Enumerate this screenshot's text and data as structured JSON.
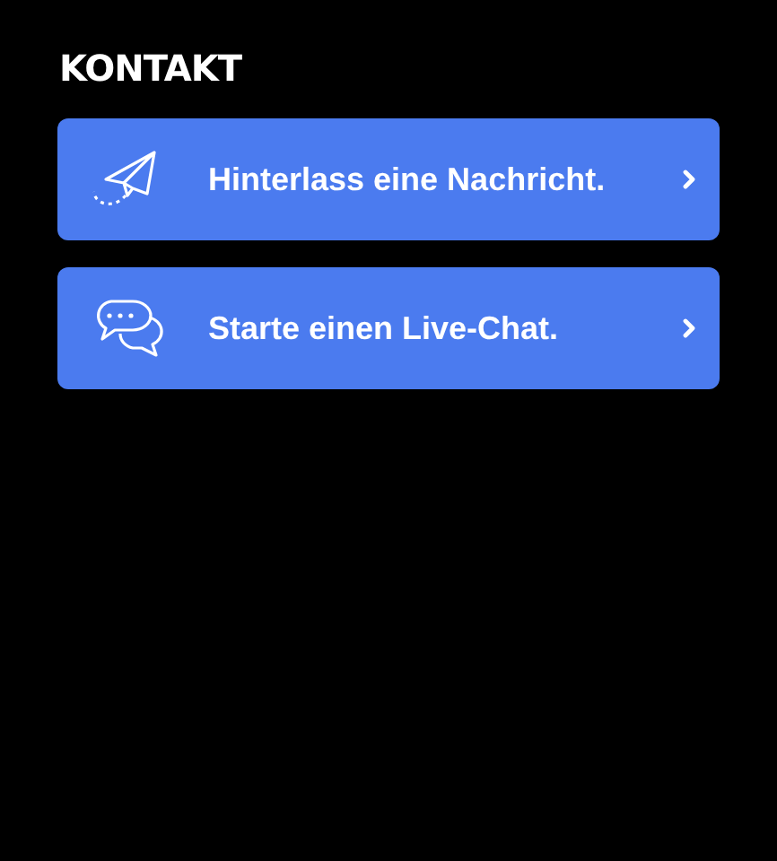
{
  "heading": "KONTAKT",
  "options": [
    {
      "kind": "message",
      "label": "Hinterlass eine Nachricht."
    },
    {
      "kind": "chat",
      "label": "Starte einen Live-Chat."
    }
  ]
}
